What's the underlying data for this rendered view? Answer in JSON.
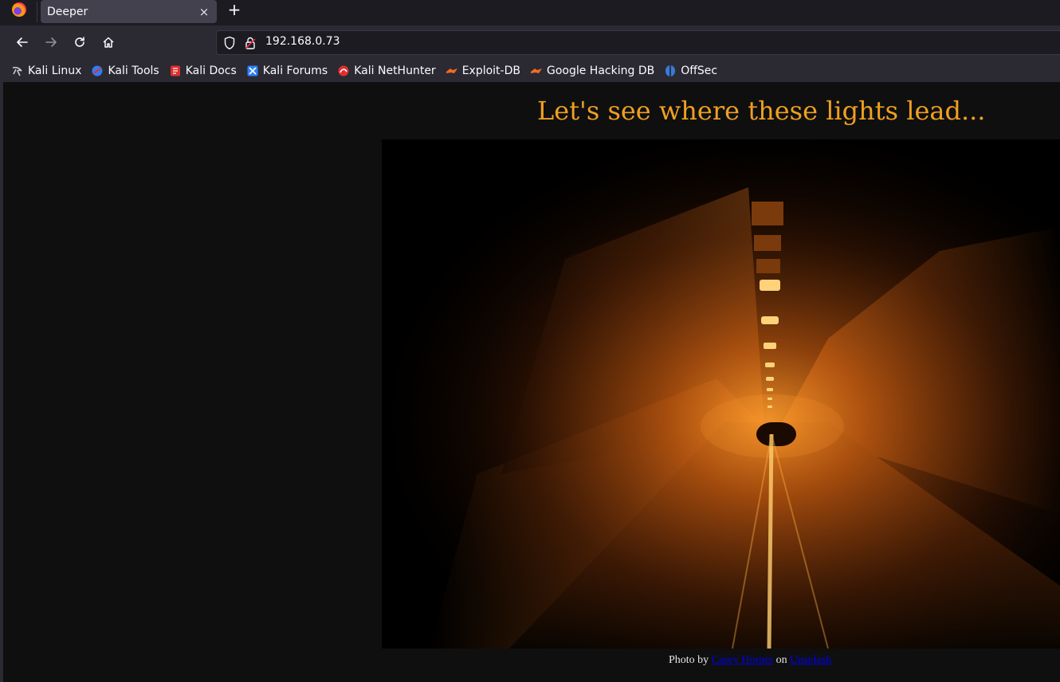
{
  "tab": {
    "title": "Deeper",
    "close_glyph": "×",
    "new_tab_glyph": "+"
  },
  "navbar": {
    "url": "192.168.0.73"
  },
  "bookmarks": [
    {
      "label": "Kali Linux",
      "icon": "kali-dragon-icon",
      "color": "#cfd2d6"
    },
    {
      "label": "Kali Tools",
      "icon": "kali-tools-icon",
      "color": "#367bf0"
    },
    {
      "label": "Kali Docs",
      "icon": "kali-docs-icon",
      "color": "#e22e2e"
    },
    {
      "label": "Kali Forums",
      "icon": "kali-forums-icon",
      "color": "#2d7ff9"
    },
    {
      "label": "Kali NetHunter",
      "icon": "nethunter-icon",
      "color": "#e22e2e"
    },
    {
      "label": "Exploit-DB",
      "icon": "exploit-db-icon",
      "color": "#f36a21"
    },
    {
      "label": "Google Hacking DB",
      "icon": "ghdb-icon",
      "color": "#f36a21"
    },
    {
      "label": "OffSec",
      "icon": "offsec-icon",
      "color": "#3a7bd5"
    }
  ],
  "page": {
    "headline": "Let's see where these lights lead...",
    "caption": {
      "prefix": "Photo by",
      "author": "Casey Horner",
      "middle": "on",
      "site": "Unsplash"
    }
  },
  "colors": {
    "headline": "#f0a020",
    "link": "#0000ee",
    "background": "#0f0f10"
  }
}
